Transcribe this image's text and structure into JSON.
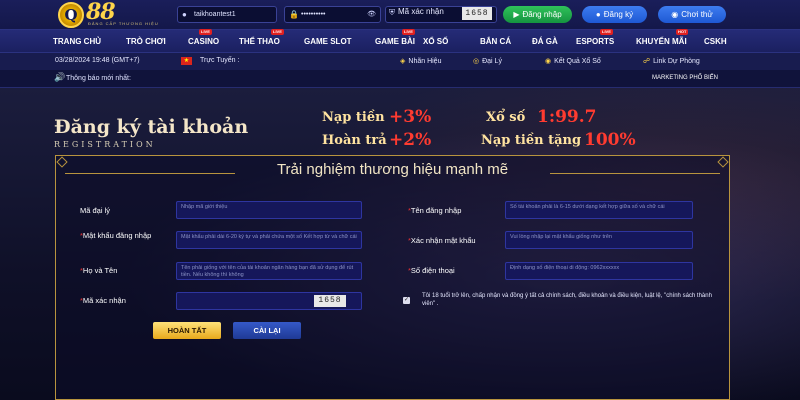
{
  "header": {
    "logo_text": "88",
    "logo_letter": "Q",
    "logo_sub": "ĐẲNG CẤP THƯƠNG HIỆU",
    "username_value": "taikhoantest1",
    "password_mask": "••••••••••",
    "captcha_label": "Mã xác nhận",
    "captcha_code": "1658",
    "login_label": "Đăng nhập",
    "register_label": "Đăng ký",
    "demo_label": "Chơi thử",
    "icons": {
      "user": "user-icon",
      "lock": "lock-icon",
      "eye": "eye-icon",
      "shield": "shield-icon"
    }
  },
  "nav": {
    "items": [
      {
        "label": "TRANG CHỦ",
        "badge": ""
      },
      {
        "label": "TRÒ CHƠI",
        "badge": ""
      },
      {
        "label": "CASINO",
        "badge": "LIVE"
      },
      {
        "label": "THỂ THAO",
        "badge": "LIVE"
      },
      {
        "label": "GAME SLOT",
        "badge": ""
      },
      {
        "label": "GAME BÀI",
        "badge": "LIVE"
      },
      {
        "label": "XỔ SỐ",
        "badge": ""
      },
      {
        "label": "BẮN CÁ",
        "badge": ""
      },
      {
        "label": "ĐÁ GÀ",
        "badge": ""
      },
      {
        "label": "ESPORTS",
        "badge": "LIVE"
      },
      {
        "label": "KHUYẾN MÃI",
        "badge": "HOT"
      },
      {
        "label": "CSKH",
        "badge": ""
      }
    ]
  },
  "infobar": {
    "datetime": "03/28/2024 19:48 (GMT+7)",
    "online_label": "Trực Tuyến :",
    "links": [
      "Nhãn Hiệu",
      "Đại Lý",
      "Kết Quả Xổ Số",
      "Link Dự Phòng"
    ]
  },
  "notice": {
    "title": "Thông báo mới nhất:",
    "marquee": "MARKETING PHỐ BIẾN"
  },
  "hero": {
    "title": "Đăng ký tài khoản",
    "subtitle": "REGISTRATION",
    "promos": [
      {
        "label": "Nạp tiền",
        "value": "+3%"
      },
      {
        "label": "Hoàn trả",
        "value": "+2%"
      },
      {
        "label": "Xổ số",
        "value": "1:99.7"
      },
      {
        "label": "Nạp tiền tặng",
        "value": "100%"
      }
    ]
  },
  "form": {
    "heading": "Trải nghiệm thương hiệu mạnh mẽ",
    "agent_label": "Mã đại lý",
    "agent_placeholder": "Nhập mã giới thiệu",
    "password_label": "Mật khẩu đăng nhập",
    "password_placeholder": "Mật khẩu phải dài 6-20 ký tự và phải chứa một số Kết hợp từ và chữ cái",
    "fullname_label": "Họ và Tên",
    "fullname_placeholder": "Tên phải giống với tên của tài khoản ngân hàng bạn đã sử dụng để rút tiền. Nếu không thì không",
    "captcha_label": "Mã xác nhận",
    "captcha_code": "1658",
    "username_label": "Tên đăng nhập",
    "username_placeholder": "Số tài khoản phải là 6-15 dưới dạng kết hợp giữa số và chữ cái",
    "confirm_label": "Xác nhận mật khẩu",
    "confirm_placeholder": "Vui lòng nhập lại mật khẩu giống như trên",
    "phone_label": "Số điện thoại",
    "phone_placeholder": "Định dạng số điện thoại di động: 0962xxxxxx",
    "terms_text": "Tôi 18 tuổi trở lên, chấp nhận và đồng ý tất cả chính sách, điều khoản và điều kiện, luật lệ, \"chính sách thành viên\" .",
    "submit_label": "HOÀN TẤT",
    "reset_label": "CÀI LẠI"
  },
  "colors": {
    "accent_gold": "#ffd54a",
    "promo_red": "#ff3b30",
    "nav_bg": "#252b77",
    "panel_border": "#b8943e"
  }
}
